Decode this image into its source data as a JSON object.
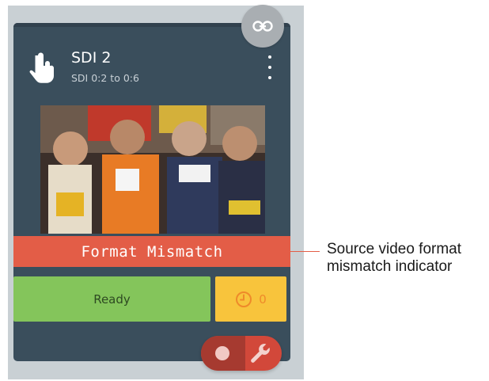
{
  "source": {
    "title": "SDI 2",
    "subtitle": "SDI 0:2 to 0:6"
  },
  "preview": {
    "banner": "Format Mismatch"
  },
  "status": {
    "ready_label": "Ready",
    "timer_count": "0"
  },
  "annotation": {
    "line1": "Source video format",
    "line2": "mismatch indicator"
  },
  "icons": {
    "link": "link-icon",
    "touch": "touch-hand-icon",
    "menu": "more-vertical-icon",
    "clock": "clock-icon",
    "record": "record-dot-icon",
    "wrench": "wrench-icon"
  },
  "colors": {
    "card": "#3a4e5c",
    "mismatch": "#e35d47",
    "ready": "#84c55b",
    "timer": "#f8c43c",
    "action": "#d2483a"
  }
}
